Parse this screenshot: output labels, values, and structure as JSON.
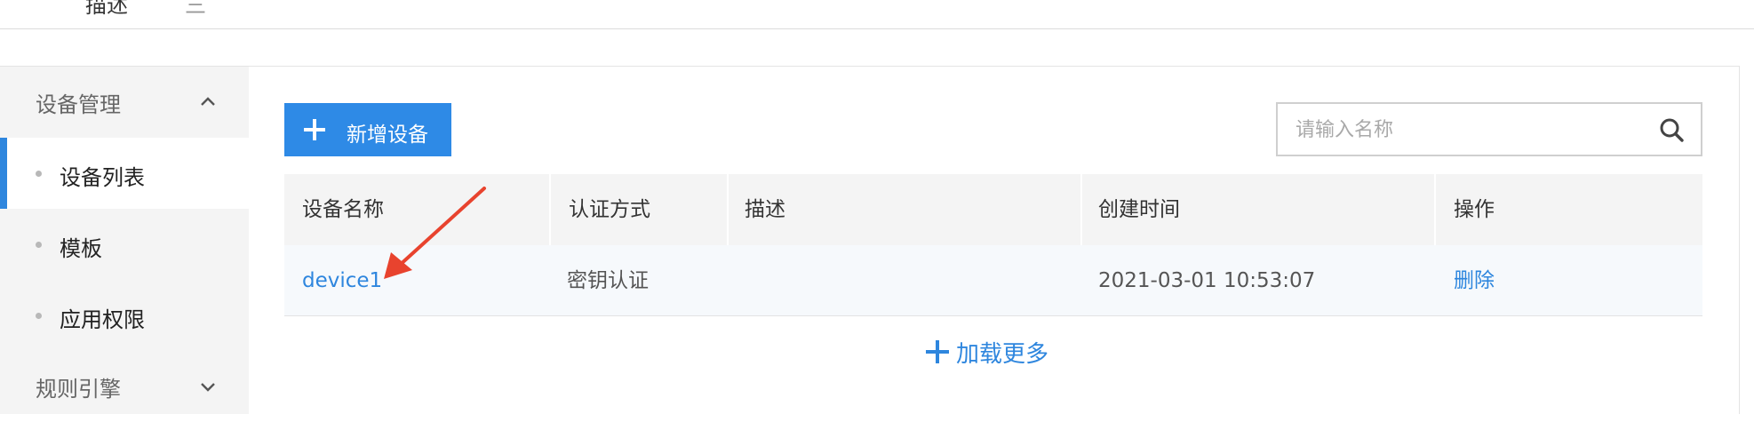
{
  "top": {
    "fragment_1": "描述",
    "fragment_2": "三"
  },
  "sidebar": {
    "group_device": {
      "label": "设备管理",
      "icon": "chevron-up-icon"
    },
    "items": [
      {
        "label": "设备列表",
        "active": true
      },
      {
        "label": "模板",
        "active": false
      },
      {
        "label": "应用权限",
        "active": false
      }
    ],
    "group_rules": {
      "label": "规则引擎",
      "icon": "chevron-down-icon"
    }
  },
  "toolbar": {
    "add_label": "新增设备",
    "add_icon": "plus-icon"
  },
  "search": {
    "placeholder": "请输入名称",
    "value": "",
    "icon": "search-icon"
  },
  "table": {
    "columns": [
      "设备名称",
      "认证方式",
      "描述",
      "创建时间",
      "操作"
    ],
    "rows": [
      {
        "name": "device1",
        "auth": "密钥认证",
        "description": "",
        "created": "2021-03-01 10:53:07",
        "action": "删除"
      }
    ],
    "load_more": "加载更多"
  },
  "colors": {
    "accent": "#2e86de",
    "annotation": "#e8432e",
    "sidebar_bg": "#f4f4f4"
  }
}
